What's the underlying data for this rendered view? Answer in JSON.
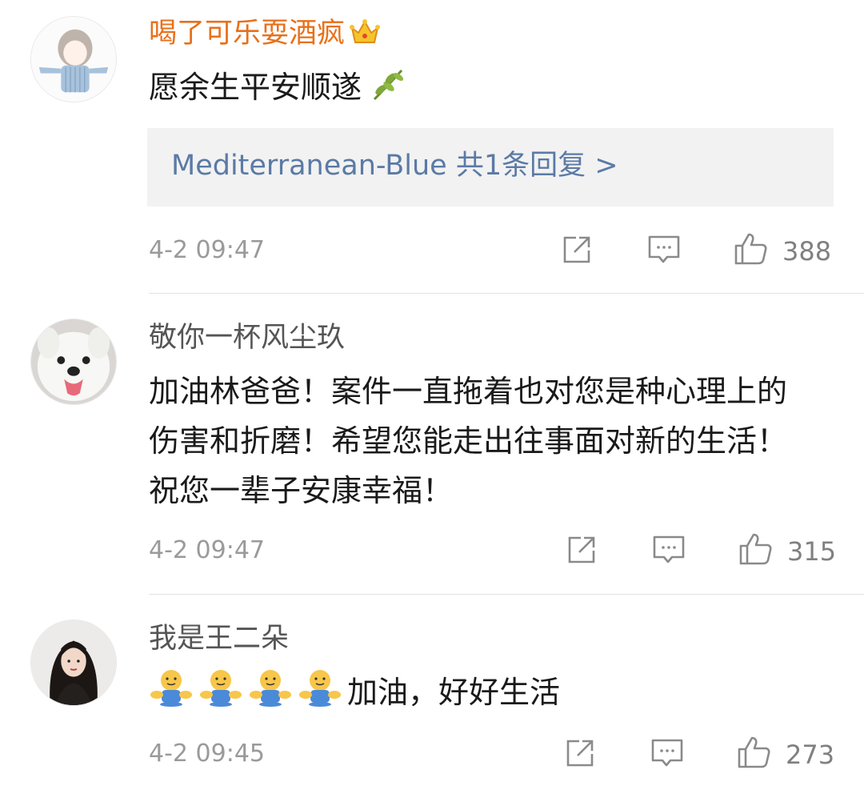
{
  "comments": [
    {
      "username": "喝了可乐耍酒疯",
      "text": "愿余生平安顺遂",
      "reply_summary": "Mediterranean-Blue  共1条回复 >",
      "time": "4-2 09:47",
      "likes": "388",
      "badge_icon": "crown-icon",
      "trailing_emoji": "olive-branch-icon"
    },
    {
      "username": "敬你一杯风尘玖",
      "text": "加油林爸爸！案件一直拖着也对您是种心理上的伤害和折磨！希望您能走出往事面对新的生活！祝您一辈子安康幸福！",
      "time": "4-2 09:47",
      "likes": "315"
    },
    {
      "username": "我是王二朵",
      "text": "加油，好好生活",
      "leading_emoji": "hug-icon",
      "leading_emoji_count": 4,
      "time": "4-2 09:45",
      "likes": "273"
    }
  ],
  "colors": {
    "vip_name": "#e8701a",
    "reply_link": "#5b7aa6",
    "meta": "#9a9a9a"
  }
}
